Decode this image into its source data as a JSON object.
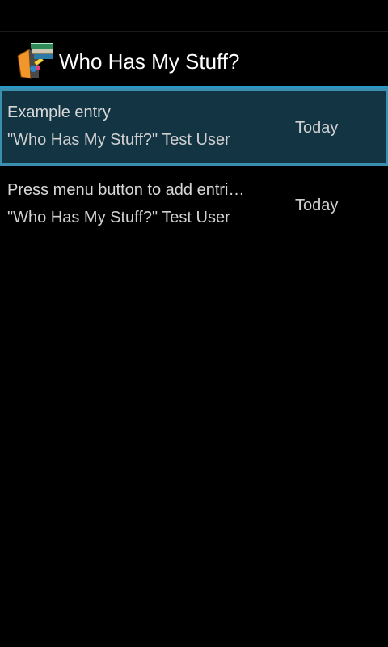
{
  "app": {
    "title": "Who Has My Stuff?",
    "icon": "books-app-icon"
  },
  "list": {
    "items": [
      {
        "title": "Example entry",
        "subtitle": "\"Who Has My Stuff?\" Test User",
        "date": "Today",
        "selected": true
      },
      {
        "title": "Press menu button to add entri…",
        "subtitle": "\"Who Has My Stuff?\" Test User",
        "date": "Today",
        "selected": false
      }
    ]
  },
  "colors": {
    "background": "#000000",
    "accent": "#33b5e5",
    "selected_background": "#123443",
    "selected_border": "#3a8fb0"
  }
}
